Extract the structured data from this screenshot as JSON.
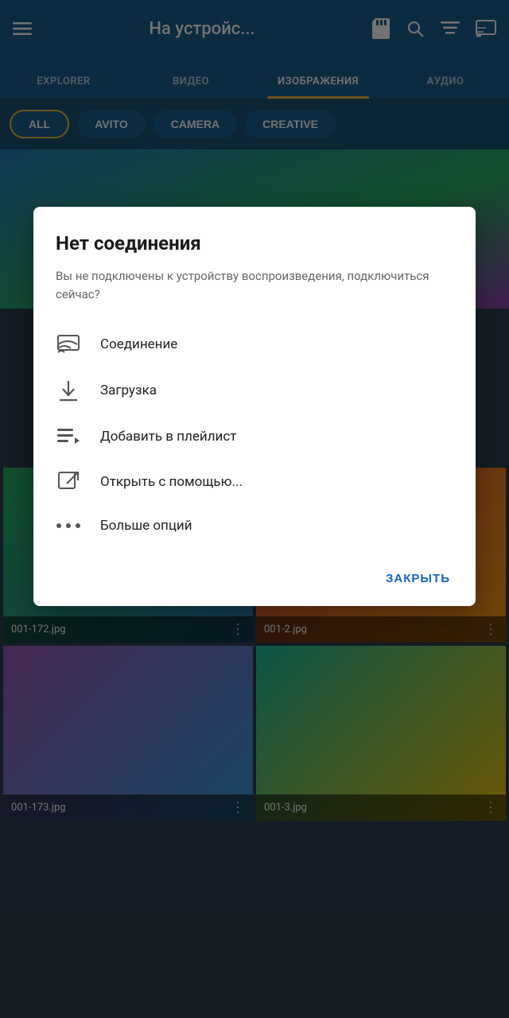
{
  "app": {
    "title": "На устройс...",
    "icons": {
      "menu": "☰",
      "sd_card": "📋",
      "search": "🔍",
      "sort": "≡",
      "cast": "⬡"
    }
  },
  "tabs": [
    {
      "id": "explorer",
      "label": "EXPLORER",
      "active": false
    },
    {
      "id": "video",
      "label": "ВИДЕО",
      "active": false
    },
    {
      "id": "images",
      "label": "ИЗОБРАЖЕНИЯ",
      "active": true
    },
    {
      "id": "audio",
      "label": "АУДИО",
      "active": false
    }
  ],
  "filters": [
    {
      "id": "all",
      "label": "ALL",
      "active": true
    },
    {
      "id": "avito",
      "label": "AVITO",
      "active": false
    },
    {
      "id": "camera",
      "label": "CAMERA",
      "active": false
    },
    {
      "id": "creative",
      "label": "CREATIVE",
      "active": false
    }
  ],
  "images": [
    {
      "id": 1,
      "filename": "001-172.jpg"
    },
    {
      "id": 2,
      "filename": "001-2.jpg"
    },
    {
      "id": 3,
      "filename": "001-173.jpg"
    },
    {
      "id": 4,
      "filename": "001-3.jpg"
    }
  ],
  "dialog": {
    "title": "Нет соединения",
    "subtitle": "Вы не подключены к устройству воспроизведения, подключиться сейчас?",
    "menu_items": [
      {
        "id": "connection",
        "label": "Соединение",
        "icon": "cast"
      },
      {
        "id": "download",
        "label": "Загрузка",
        "icon": "download"
      },
      {
        "id": "playlist",
        "label": "Добавить в плейлист",
        "icon": "playlist"
      },
      {
        "id": "open_with",
        "label": "Открыть с помощью...",
        "icon": "open_external"
      },
      {
        "id": "more",
        "label": "Больше опций",
        "icon": "more"
      }
    ],
    "close_button_label": "ЗАКРЫТЬ"
  }
}
